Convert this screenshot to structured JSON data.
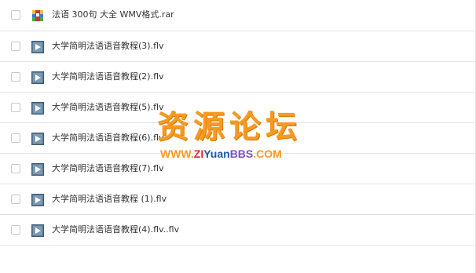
{
  "files": [
    {
      "name": "法语 300句 大全 WMV格式.rar",
      "icon": "archive-icon"
    },
    {
      "name": "大学简明法语语音教程(3).flv",
      "icon": "video-icon"
    },
    {
      "name": "大学简明法语语音教程(2).flv",
      "icon": "video-icon"
    },
    {
      "name": "大学简明法语语音教程(5).flv",
      "icon": "video-icon"
    },
    {
      "name": "大学简明法语语音教程(6).flv",
      "icon": "video-icon"
    },
    {
      "name": "大学简明法语语音教程(7).flv",
      "icon": "video-icon"
    },
    {
      "name": "大学简明法语语音教程 (1).flv",
      "icon": "video-icon"
    },
    {
      "name": "大学简明法语语音教程(4).flv..flv",
      "icon": "video-icon"
    }
  ],
  "watermark": {
    "title": "资源论坛",
    "url_parts": [
      "WWW.",
      "ZI",
      " Yuan",
      " BBS",
      " .COM"
    ],
    "colors": {
      "orange": "#f59a23",
      "blue": "#1a5aa6",
      "red": "#d9262b",
      "purple": "#7a4fc4"
    }
  }
}
